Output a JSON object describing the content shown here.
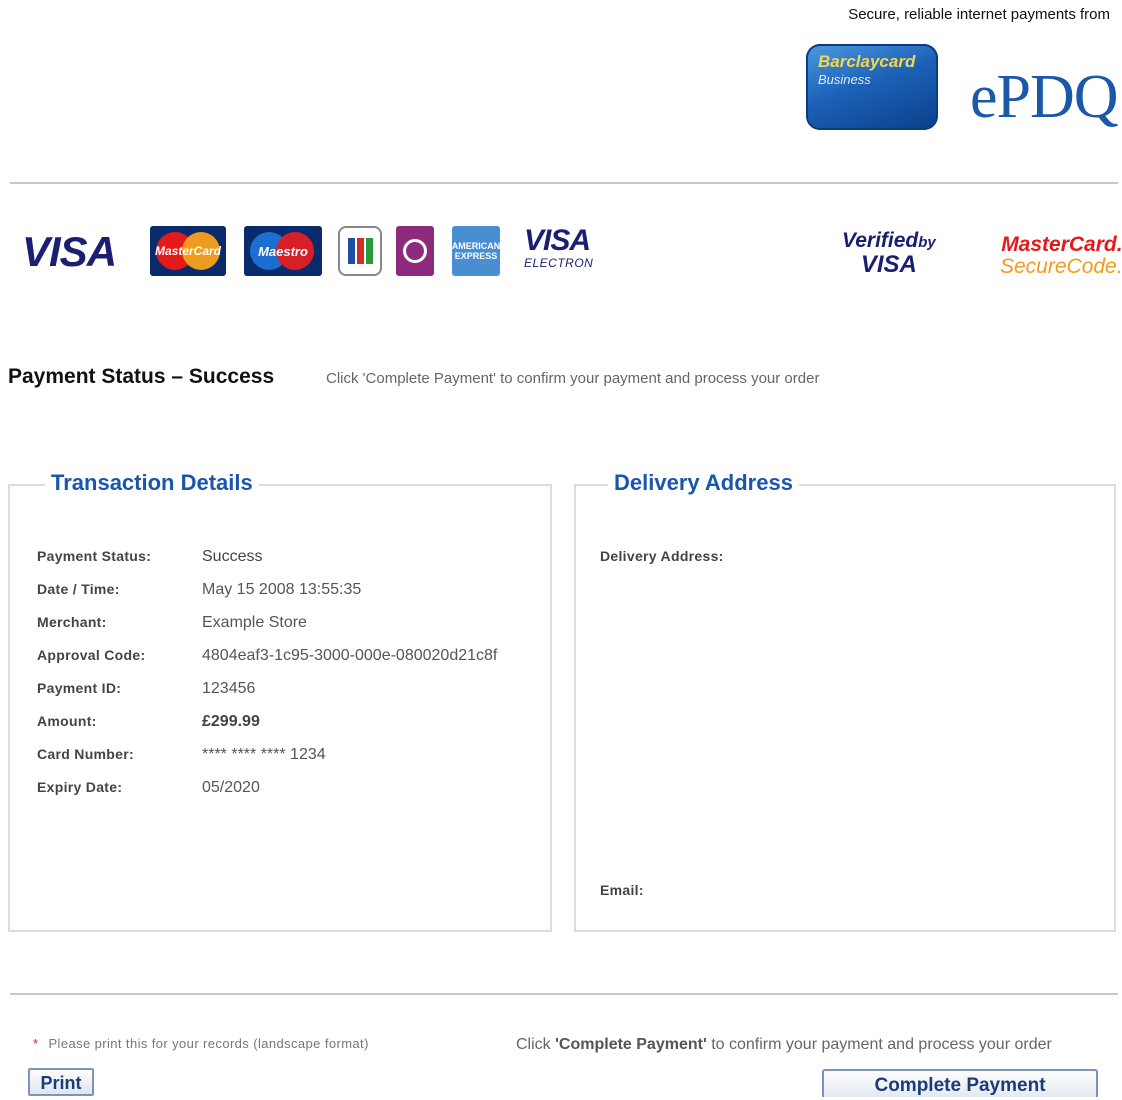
{
  "header": {
    "tagline": "Secure, reliable internet payments from",
    "barclaycard_logo": {
      "line1": "Barclaycard",
      "line2": "Business"
    },
    "epdq_logo": "ePDQ"
  },
  "card_logos": {
    "visa": "VISA",
    "mastercard": "MasterCard",
    "maestro": "Maestro",
    "jcb": "JCB",
    "solo": "SOLO",
    "amex": "AMERICAN EXPRESS",
    "visa_electron": {
      "line1": "VISA",
      "line2": "ELECTRON"
    },
    "verified_by_visa": {
      "line1": "Verified",
      "by": "by",
      "line2": "VISA"
    },
    "mastercard_securecode": {
      "line1": "MasterCard.",
      "line2": "SecureCode."
    }
  },
  "status": {
    "title": "Payment Status – Success",
    "hint": "Click 'Complete Payment' to confirm your payment and process your order"
  },
  "transaction": {
    "legend": "Transaction Details",
    "rows": [
      {
        "label": "Payment Status:",
        "value": "Success"
      },
      {
        "label": "Date / Time:",
        "value": "May 15 2008 13:55:35"
      },
      {
        "label": "Merchant:",
        "value": "Example Store"
      },
      {
        "label": "Approval Code:",
        "value": "4804eaf3-1c95-3000-000e-080020d21c8f"
      },
      {
        "label": "Payment ID:",
        "value": "123456"
      },
      {
        "label": "Amount:",
        "value": "£299.99"
      },
      {
        "label": "Card Number:",
        "value": "**** **** **** 1234"
      },
      {
        "label": "Expiry Date:",
        "value": "05/2020"
      }
    ]
  },
  "delivery": {
    "legend": "Delivery Address",
    "address_label": "Delivery Address:",
    "email_label": "Email:"
  },
  "footer": {
    "star": "*",
    "note": "Please print this for your records (landscape format)",
    "hint_prefix": "Click ",
    "hint_bold": "'Complete Payment'",
    "hint_suffix": " to confirm your payment and process your order",
    "print_label": "Print",
    "complete_label": "Complete Payment"
  }
}
